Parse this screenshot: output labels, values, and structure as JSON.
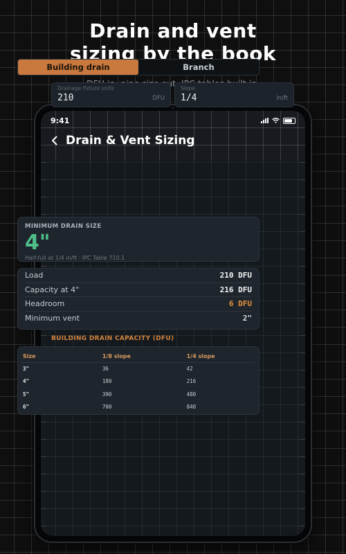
{
  "hero": {
    "title_line1": "Drain and vent",
    "title_line2": "sizing by the book",
    "subtitle": "DFU in, pipe size out. IPC tables built in."
  },
  "status_bar": {
    "time": "9:41"
  },
  "nav": {
    "title": "Drain & Vent Sizing"
  },
  "tabs": [
    {
      "label": "Building drain",
      "active": true
    },
    {
      "label": "Branch",
      "active": false
    }
  ],
  "inputs": {
    "load": {
      "label": "Drainage fixture units",
      "value": "210",
      "unit": "DFU"
    },
    "slope": {
      "label": "Slope",
      "value": "1/4",
      "unit": "in/ft"
    }
  },
  "result": {
    "label": "MINIMUM DRAIN SIZE",
    "value": "4\"",
    "note": "Half-full at 1/4 in/ft · IPC Table 710.1"
  },
  "metrics": [
    {
      "name": "Load",
      "value": "210 DFU"
    },
    {
      "name": "Capacity at 4\"",
      "value": "216 DFU"
    },
    {
      "name": "Headroom",
      "value": "6 DFU"
    },
    {
      "name": "Minimum vent",
      "value": "2\""
    }
  ],
  "capacity_table": {
    "title": "BUILDING DRAIN CAPACITY (DFU)",
    "headers": [
      "Size",
      "1/8 slope",
      "1/4 slope"
    ],
    "rows": [
      [
        "3\"",
        "36",
        "42"
      ],
      [
        "4\"",
        "180",
        "216"
      ],
      [
        "5\"",
        "390",
        "480"
      ],
      [
        "6\"",
        "700",
        "840"
      ]
    ]
  },
  "colors": {
    "accent": "#c9793e",
    "result_green": "#4fbf8a",
    "warning_orange": "#e2913f",
    "card_bg": "#1f252c"
  },
  "icons": [
    "back-chevron-icon",
    "signal-icon",
    "wifi-icon",
    "battery-icon"
  ]
}
